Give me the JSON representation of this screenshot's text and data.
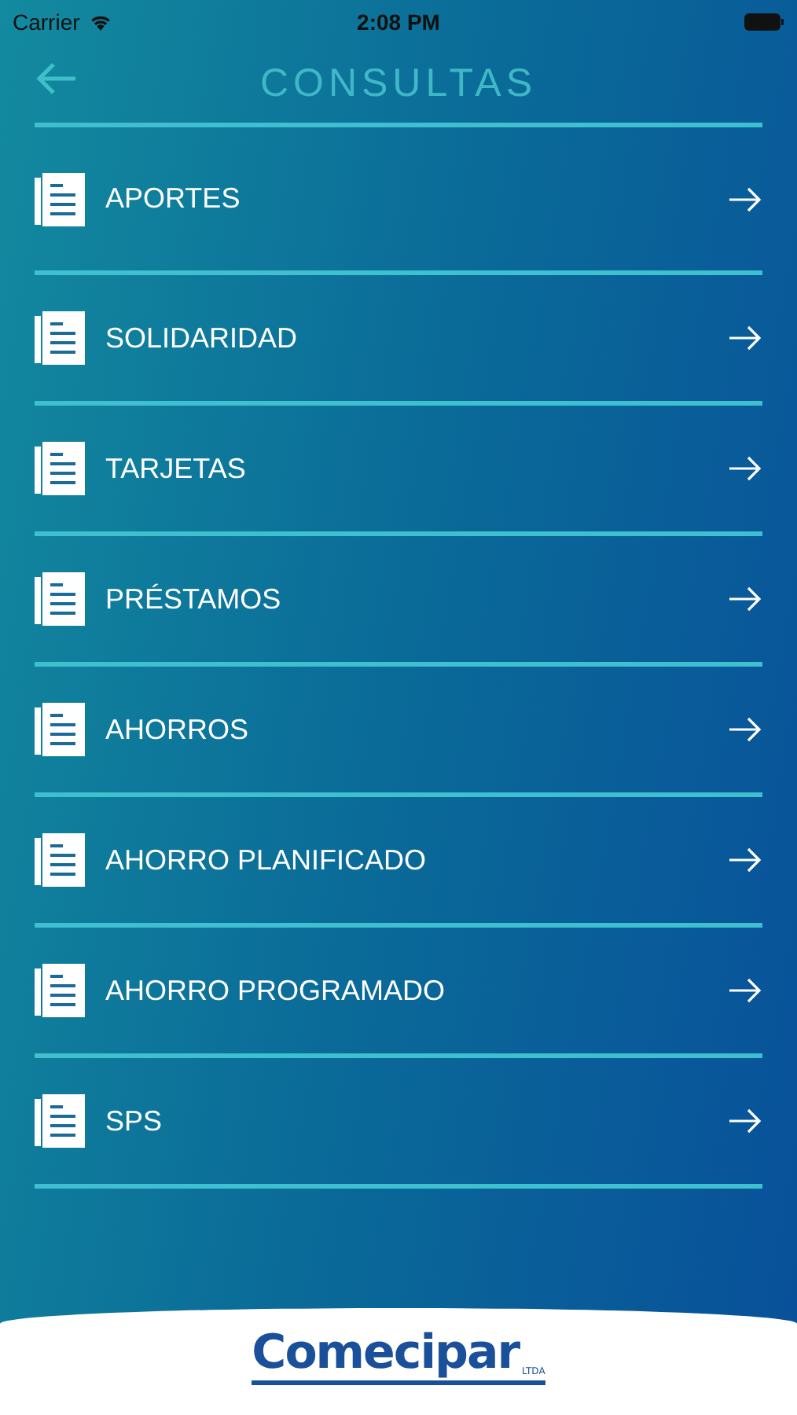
{
  "status_bar": {
    "carrier": "Carrier",
    "time": "2:08 PM"
  },
  "header": {
    "title": "CONSULTAS"
  },
  "menu_items": [
    {
      "label": "APORTES"
    },
    {
      "label": "SOLIDARIDAD"
    },
    {
      "label": "TARJETAS"
    },
    {
      "label": "PRÉSTAMOS"
    },
    {
      "label": "AHORROS"
    },
    {
      "label": "AHORRO PLANIFICADO"
    },
    {
      "label": "AHORRO PROGRAMADO"
    },
    {
      "label": "SPS"
    }
  ],
  "footer": {
    "logo": "Comecipar",
    "logo_suffix": "LTDA"
  }
}
